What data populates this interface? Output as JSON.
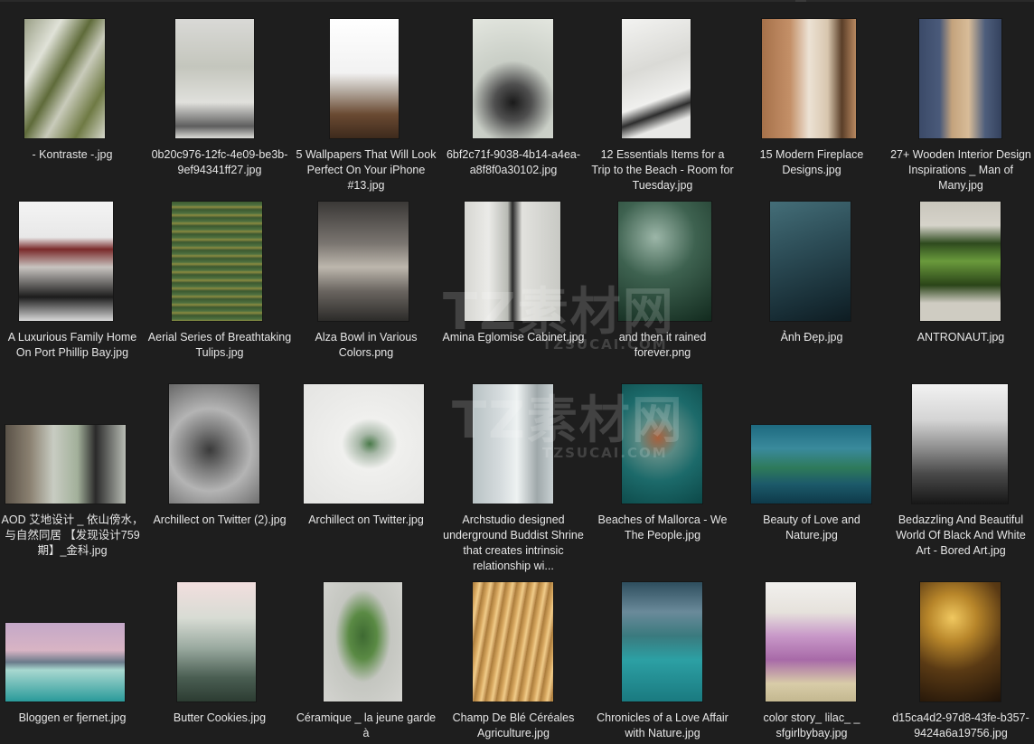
{
  "watermark": {
    "brand": "TZ素材网",
    "sub": "TZSUCAI.COM"
  },
  "files": [
    {
      "name": "- Kontraste -.jpg",
      "gradient": "linear-gradient(120deg,#9a9f86 0%,#e0e2d8 25%,#5f6b3a 45%,#c9cbbb 60%,#6f7a44 80%,#d6d8cc 100%)"
    },
    {
      "name": "0b20c976-12fc-4e09-be3b-9ef94341ff27.jpg",
      "gradient": "linear-gradient(180deg,#d9d9d6 0%,#c4c6bd 40%,#e0e0dc 70%,#5e5e5e 90%,#dcdcd8 100%)"
    },
    {
      "name": "5 Wallpapers That Will Look Perfect On Your iPhone #13.jpg",
      "gradient": "linear-gradient(180deg,#ffffff 0%,#f2f2f2 45%,#b6aca2 60%,#6a4a32 80%,#3e2a1c 100%)"
    },
    {
      "name": "6bf2c71f-9038-4b14-a4ea-a8f8f0a30102.jpg",
      "gradient": "radial-gradient(circle at 50% 70%,#1a1a1a 0%,#505050 20%,#c9cec6 45%,#e3e6df 100%)"
    },
    {
      "name": "12 Essentials Items for a Trip to the Beach - Room for Tuesday.jpg",
      "gradient": "linear-gradient(160deg,#f3f3f1 0%,#dadad6 40%,#f0f0ee 65%,#2e2e2e 75%,#e8e8e6 85%)"
    },
    {
      "name": "15 Modern Fireplace Designs.jpg",
      "gradient": "linear-gradient(90deg,#a6714a 0%,#c49068 30%,#ece2d4 50%,#d8c6ae 70%,#5a3e28 85%,#b88860 100%)"
    },
    {
      "name": "27+ Wooden Interior Design Inspirations _ Man of Many.jpg",
      "gradient": "linear-gradient(90deg,#3b4a68 0%,#4a5a7a 25%,#c4a37d 40%,#d8bc98 60%,#4e5e7c 80%,#34425e 100%)"
    },
    {
      "name": "A Luxurious Family Home On Port Phillip Bay.jpg",
      "gradient": "linear-gradient(180deg,#f4f4f4 0%,#e8e8e8 30%,#7a2a2a 40%,#c8c4c0 55%,#1c1c1c 80%,#d8d8d8 100%)"
    },
    {
      "name": "Aerial Series of Breathtaking Tulips.jpg",
      "gradient": "repeating-linear-gradient(180deg,#3c5a30 0px,#4e7040 4px,#8a8a40 6px,#3a5530 9px)"
    },
    {
      "name": "Alza Bowl in Various Colors.png",
      "gradient": "linear-gradient(180deg,#3a3836 0%,#7a7570 35%,#bdb7ad 55%,#6a6560 75%,#2c2b29 100%)"
    },
    {
      "name": "Amina Eglomise Cabinet.jpg",
      "gradient": "linear-gradient(90deg,#d6d6d2 0%,#ebebe8 25%,#b8bab4 45%,#2a2a2a 50%,#e2e2de 60%,#c8c9c4 100%)"
    },
    {
      "name": "and then it rained forever.png",
      "gradient": "radial-gradient(circle at 40% 30%,#9cb6a8 0%,#3e6250 40%,#122a1e 100%)"
    },
    {
      "name": "Ảnh Đẹp.jpg",
      "gradient": "linear-gradient(160deg,#446e78 0%,#2c4c56 40%,#172c34 80%,#0e1c22 100%)"
    },
    {
      "name": "ANTRONAUT.jpg",
      "gradient": "linear-gradient(180deg,#c9c6bc 0%,#d6d3ca 20%,#2e4a1e 35%,#6a9a3c 50%,#2a4418 70%,#cfccc2 85%)"
    },
    {
      "name": "AOD 艾地设计 _ 依山傍水，与自然同居 【发现设计759期】_金科.jpg",
      "gradient": "linear-gradient(90deg,#5a5248 0%,#8a8070 20%,#c8ccc2 40%,#a2b09a 60%,#2a2a2a 75%,#b8bcb4 100%)"
    },
    {
      "name": "Archillect on Twitter (2).jpg",
      "gradient": "radial-gradient(circle at 45% 55%,#3a3a3a 0%,#7a7a7a 25%,#b4b4b4 50%,#5c5c5c 100%)"
    },
    {
      "name": "Archillect on Twitter.jpg",
      "gradient": "radial-gradient(ellipse at 55% 50%,#4a7a4a 0%,#a8b8a8 12%,#f0f0ee 30%,#e4e4e2 100%)"
    },
    {
      "name": "Archstudio designed underground Buddist Shrine that creates intrinsic relationship wi...",
      "gradient": "linear-gradient(90deg,#b8c2c4 0%,#d6dcde 35%,#eef2f2 55%,#9fa8aa 80%,#c8d0d2 100%)"
    },
    {
      "name": "Beaches of Mallorca - We The People.jpg",
      "gradient": "radial-gradient(circle at 45% 45%,#a8603c 0%,#5a8a84 25%,#1c6a6a 55%,#0c4848 100%)"
    },
    {
      "name": "Beauty of Love and Nature.jpg",
      "gradient": "linear-gradient(180deg,#1e6a80 0%,#3a8a9c 30%,#2e7a5a 55%,#1c5a6a 75%,#0e3a4a 100%)"
    },
    {
      "name": "Bedazzling And Beautiful World Of Black And White Art - Bored Art.jpg",
      "gradient": "linear-gradient(180deg,#f2f2f2 0%,#d4d4d4 30%,#8a8a8a 55%,#4a4a4a 75%,#181818 100%)"
    },
    {
      "name": "Bloggen er fjernet.jpg",
      "gradient": "linear-gradient(180deg,#c4a8c8 0%,#d8b4c4 35%,#6a7a8a 50%,#a8d8d0 60%,#2a9a9a 100%)"
    },
    {
      "name": "Butter Cookies.jpg",
      "gradient": "linear-gradient(180deg,#f2dede 0%,#d8dcd4 30%,#9aaaa0 55%,#4a5e52 80%,#2c3c32 100%)"
    },
    {
      "name": "Céramique _ la jeune garde à",
      "gradient": "radial-gradient(ellipse at 50% 45%,#3e6a32 0%,#5a8a44 25%,#c4c6c0 50%,#d4d4d0 100%)"
    },
    {
      "name": "Champ De Blé Céréales Agriculture.jpg",
      "gradient": "repeating-linear-gradient(100deg,#a87a3a 0px,#d8a860 5px,#f0cc8a 8px,#b8884a 12px)"
    },
    {
      "name": "Chronicles of a Love Affair with Nature.jpg",
      "gradient": "linear-gradient(180deg,#2e4e5e 0%,#6a8a9a 25%,#3a7a7e 45%,#2ca0a4 65%,#1a7a80 100%)"
    },
    {
      "name": "color story_ lilac_ _ sfgirlbybay.jpg",
      "gradient": "linear-gradient(180deg,#f2f0ee 0%,#e6e2dc 25%,#c898c8 45%,#a86aa8 65%,#d8cca8 85%,#c4b890 100%)"
    },
    {
      "name": "d15ca4d2-97d8-43fe-b357-9424a6a19756.jpg",
      "gradient": "radial-gradient(circle at 40% 30%,#f0c860 0%,#b8862a 25%,#5a3a14 55%,#1e1208 100%)"
    }
  ]
}
